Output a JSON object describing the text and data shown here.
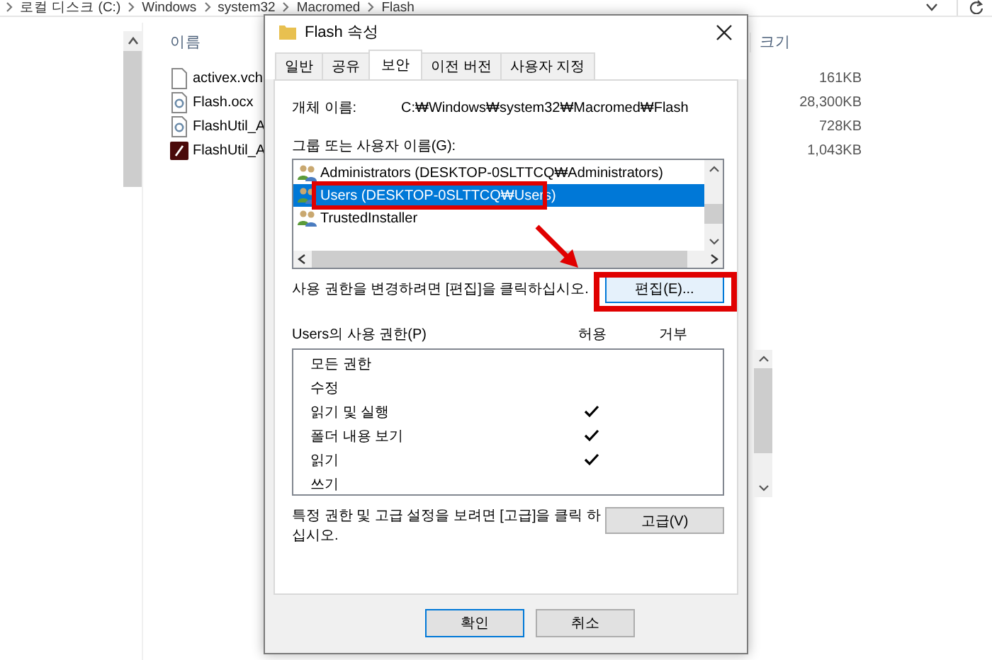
{
  "explorer": {
    "breadcrumb": [
      "로컬 디스크 (C:)",
      "Windows",
      "system32",
      "Macromed",
      "Flash"
    ],
    "columns": [
      "이름",
      "크기"
    ],
    "files": [
      {
        "kind": "blank",
        "name": "activex.vch",
        "size": "161KB"
      },
      {
        "kind": "gear",
        "name": "Flash.ocx",
        "size": "28,300KB"
      },
      {
        "kind": "gear",
        "name": "FlashUtil_A",
        "size": "728KB"
      },
      {
        "kind": "app",
        "name": "FlashUtil_A",
        "size": "1,043KB"
      }
    ]
  },
  "dialog": {
    "title": "Flash 속성",
    "tabs": [
      {
        "label": "일반",
        "selected": false
      },
      {
        "label": "공유",
        "selected": false
      },
      {
        "label": "보안",
        "selected": true
      },
      {
        "label": "이전 버전",
        "selected": false
      },
      {
        "label": "사용자 지정",
        "selected": false
      }
    ],
    "object_label": "개체 이름:",
    "object_value": "C:₩Windows₩system32₩Macromed₩Flash",
    "groups_label": "그룹 또는 사용자 이름(G):",
    "groups": [
      {
        "name": "Administrators (DESKTOP-0SLTTCQ₩Administrators)",
        "selected": false
      },
      {
        "name": "Users (DESKTOP-0SLTTCQ₩Users)",
        "selected": true
      },
      {
        "name": "TrustedInstaller",
        "selected": false
      }
    ],
    "edit_hint": "사용 권한을 변경하려면 [편집]을 클릭하십시오.",
    "edit_button": "편집(E)...",
    "perm_label": "Users의 사용 권한(P)",
    "allow_label": "허용",
    "deny_label": "거부",
    "permissions": [
      {
        "name": "모든 권한",
        "allow": false,
        "deny": false
      },
      {
        "name": "수정",
        "allow": false,
        "deny": false
      },
      {
        "name": "읽기 및 실행",
        "allow": true,
        "deny": false
      },
      {
        "name": "폴더 내용 보기",
        "allow": true,
        "deny": false
      },
      {
        "name": "읽기",
        "allow": true,
        "deny": false
      },
      {
        "name": "쓰기",
        "allow": false,
        "deny": false
      }
    ],
    "advanced_hint": "특정 권한 및 고급 설정을 보려면 [고급]을 클릭 하십시오.",
    "advanced_button": "고급(V)",
    "buttons": [
      "확인",
      "취소"
    ]
  }
}
